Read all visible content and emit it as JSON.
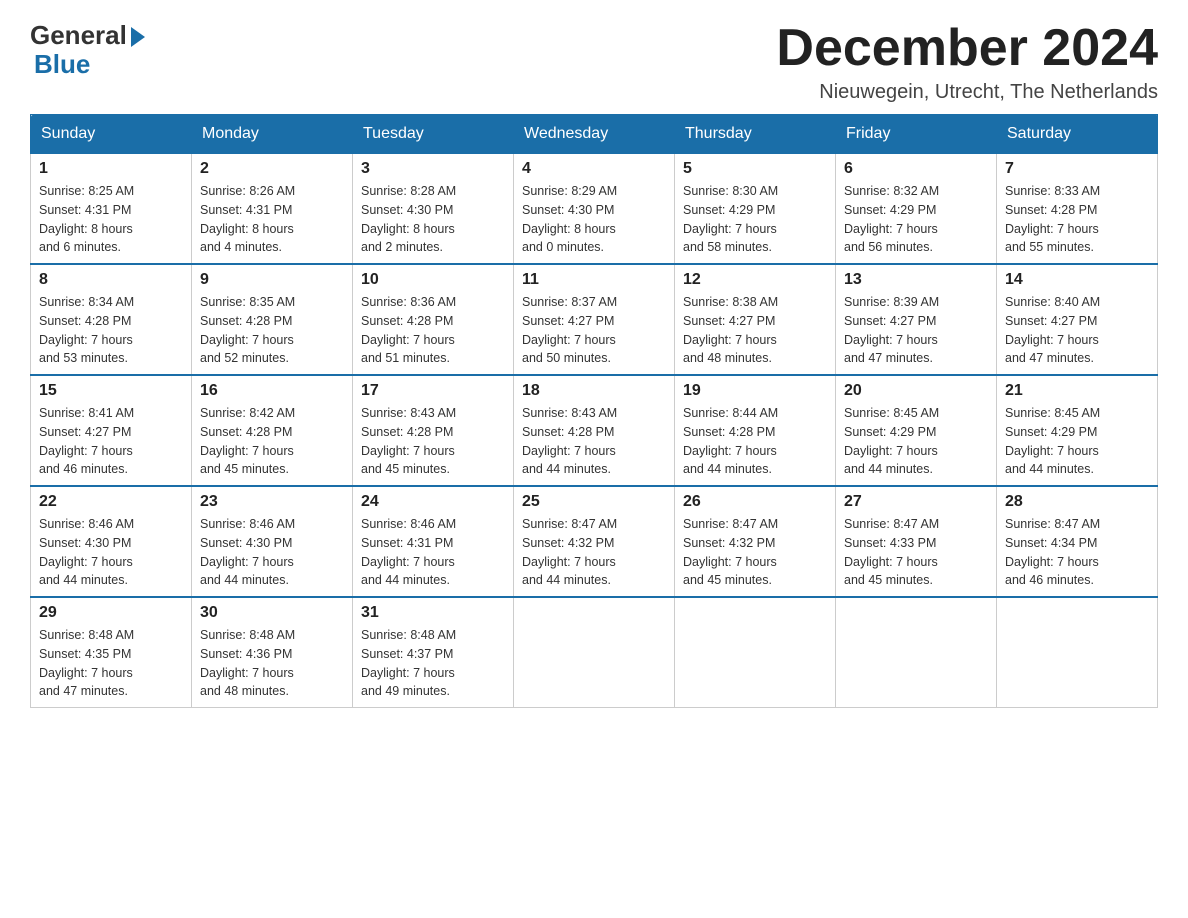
{
  "logo": {
    "general": "General",
    "blue": "Blue"
  },
  "header": {
    "month_year": "December 2024",
    "location": "Nieuwegein, Utrecht, The Netherlands"
  },
  "weekdays": [
    "Sunday",
    "Monday",
    "Tuesday",
    "Wednesday",
    "Thursday",
    "Friday",
    "Saturday"
  ],
  "weeks": [
    [
      {
        "day": "1",
        "sunrise": "Sunrise: 8:25 AM",
        "sunset": "Sunset: 4:31 PM",
        "daylight": "Daylight: 8 hours",
        "minutes": "and 6 minutes."
      },
      {
        "day": "2",
        "sunrise": "Sunrise: 8:26 AM",
        "sunset": "Sunset: 4:31 PM",
        "daylight": "Daylight: 8 hours",
        "minutes": "and 4 minutes."
      },
      {
        "day": "3",
        "sunrise": "Sunrise: 8:28 AM",
        "sunset": "Sunset: 4:30 PM",
        "daylight": "Daylight: 8 hours",
        "minutes": "and 2 minutes."
      },
      {
        "day": "4",
        "sunrise": "Sunrise: 8:29 AM",
        "sunset": "Sunset: 4:30 PM",
        "daylight": "Daylight: 8 hours",
        "minutes": "and 0 minutes."
      },
      {
        "day": "5",
        "sunrise": "Sunrise: 8:30 AM",
        "sunset": "Sunset: 4:29 PM",
        "daylight": "Daylight: 7 hours",
        "minutes": "and 58 minutes."
      },
      {
        "day": "6",
        "sunrise": "Sunrise: 8:32 AM",
        "sunset": "Sunset: 4:29 PM",
        "daylight": "Daylight: 7 hours",
        "minutes": "and 56 minutes."
      },
      {
        "day": "7",
        "sunrise": "Sunrise: 8:33 AM",
        "sunset": "Sunset: 4:28 PM",
        "daylight": "Daylight: 7 hours",
        "minutes": "and 55 minutes."
      }
    ],
    [
      {
        "day": "8",
        "sunrise": "Sunrise: 8:34 AM",
        "sunset": "Sunset: 4:28 PM",
        "daylight": "Daylight: 7 hours",
        "minutes": "and 53 minutes."
      },
      {
        "day": "9",
        "sunrise": "Sunrise: 8:35 AM",
        "sunset": "Sunset: 4:28 PM",
        "daylight": "Daylight: 7 hours",
        "minutes": "and 52 minutes."
      },
      {
        "day": "10",
        "sunrise": "Sunrise: 8:36 AM",
        "sunset": "Sunset: 4:28 PM",
        "daylight": "Daylight: 7 hours",
        "minutes": "and 51 minutes."
      },
      {
        "day": "11",
        "sunrise": "Sunrise: 8:37 AM",
        "sunset": "Sunset: 4:27 PM",
        "daylight": "Daylight: 7 hours",
        "minutes": "and 50 minutes."
      },
      {
        "day": "12",
        "sunrise": "Sunrise: 8:38 AM",
        "sunset": "Sunset: 4:27 PM",
        "daylight": "Daylight: 7 hours",
        "minutes": "and 48 minutes."
      },
      {
        "day": "13",
        "sunrise": "Sunrise: 8:39 AM",
        "sunset": "Sunset: 4:27 PM",
        "daylight": "Daylight: 7 hours",
        "minutes": "and 47 minutes."
      },
      {
        "day": "14",
        "sunrise": "Sunrise: 8:40 AM",
        "sunset": "Sunset: 4:27 PM",
        "daylight": "Daylight: 7 hours",
        "minutes": "and 47 minutes."
      }
    ],
    [
      {
        "day": "15",
        "sunrise": "Sunrise: 8:41 AM",
        "sunset": "Sunset: 4:27 PM",
        "daylight": "Daylight: 7 hours",
        "minutes": "and 46 minutes."
      },
      {
        "day": "16",
        "sunrise": "Sunrise: 8:42 AM",
        "sunset": "Sunset: 4:28 PM",
        "daylight": "Daylight: 7 hours",
        "minutes": "and 45 minutes."
      },
      {
        "day": "17",
        "sunrise": "Sunrise: 8:43 AM",
        "sunset": "Sunset: 4:28 PM",
        "daylight": "Daylight: 7 hours",
        "minutes": "and 45 minutes."
      },
      {
        "day": "18",
        "sunrise": "Sunrise: 8:43 AM",
        "sunset": "Sunset: 4:28 PM",
        "daylight": "Daylight: 7 hours",
        "minutes": "and 44 minutes."
      },
      {
        "day": "19",
        "sunrise": "Sunrise: 8:44 AM",
        "sunset": "Sunset: 4:28 PM",
        "daylight": "Daylight: 7 hours",
        "minutes": "and 44 minutes."
      },
      {
        "day": "20",
        "sunrise": "Sunrise: 8:45 AM",
        "sunset": "Sunset: 4:29 PM",
        "daylight": "Daylight: 7 hours",
        "minutes": "and 44 minutes."
      },
      {
        "day": "21",
        "sunrise": "Sunrise: 8:45 AM",
        "sunset": "Sunset: 4:29 PM",
        "daylight": "Daylight: 7 hours",
        "minutes": "and 44 minutes."
      }
    ],
    [
      {
        "day": "22",
        "sunrise": "Sunrise: 8:46 AM",
        "sunset": "Sunset: 4:30 PM",
        "daylight": "Daylight: 7 hours",
        "minutes": "and 44 minutes."
      },
      {
        "day": "23",
        "sunrise": "Sunrise: 8:46 AM",
        "sunset": "Sunset: 4:30 PM",
        "daylight": "Daylight: 7 hours",
        "minutes": "and 44 minutes."
      },
      {
        "day": "24",
        "sunrise": "Sunrise: 8:46 AM",
        "sunset": "Sunset: 4:31 PM",
        "daylight": "Daylight: 7 hours",
        "minutes": "and 44 minutes."
      },
      {
        "day": "25",
        "sunrise": "Sunrise: 8:47 AM",
        "sunset": "Sunset: 4:32 PM",
        "daylight": "Daylight: 7 hours",
        "minutes": "and 44 minutes."
      },
      {
        "day": "26",
        "sunrise": "Sunrise: 8:47 AM",
        "sunset": "Sunset: 4:32 PM",
        "daylight": "Daylight: 7 hours",
        "minutes": "and 45 minutes."
      },
      {
        "day": "27",
        "sunrise": "Sunrise: 8:47 AM",
        "sunset": "Sunset: 4:33 PM",
        "daylight": "Daylight: 7 hours",
        "minutes": "and 45 minutes."
      },
      {
        "day": "28",
        "sunrise": "Sunrise: 8:47 AM",
        "sunset": "Sunset: 4:34 PM",
        "daylight": "Daylight: 7 hours",
        "minutes": "and 46 minutes."
      }
    ],
    [
      {
        "day": "29",
        "sunrise": "Sunrise: 8:48 AM",
        "sunset": "Sunset: 4:35 PM",
        "daylight": "Daylight: 7 hours",
        "minutes": "and 47 minutes."
      },
      {
        "day": "30",
        "sunrise": "Sunrise: 8:48 AM",
        "sunset": "Sunset: 4:36 PM",
        "daylight": "Daylight: 7 hours",
        "minutes": "and 48 minutes."
      },
      {
        "day": "31",
        "sunrise": "Sunrise: 8:48 AM",
        "sunset": "Sunset: 4:37 PM",
        "daylight": "Daylight: 7 hours",
        "minutes": "and 49 minutes."
      },
      null,
      null,
      null,
      null
    ]
  ]
}
